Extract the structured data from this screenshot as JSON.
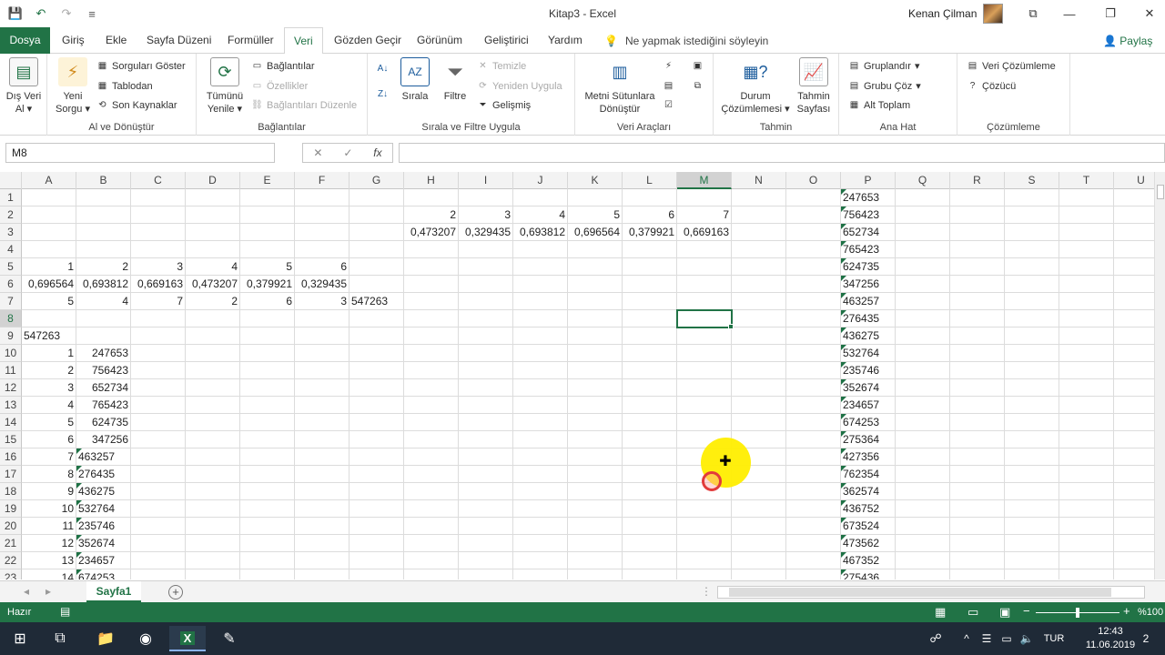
{
  "window": {
    "title": "Kitap3  -  Excel",
    "user": "Kenan Çilman"
  },
  "tabs": {
    "dosya": "Dosya",
    "giris": "Giriş",
    "ekle": "Ekle",
    "sayfa_duzeni": "Sayfa Düzeni",
    "formuller": "Formüller",
    "veri": "Veri",
    "gozden_gecir": "Gözden Geçir",
    "gorunum": "Görünüm",
    "gelistirici": "Geliştirici",
    "yardim": "Yardım",
    "tell_me": "Ne yapmak istediğini söyleyin",
    "share": "Paylaş"
  },
  "ribbon": {
    "dis_veri": [
      "Dış Veri",
      "Al ▾"
    ],
    "yeni_sorgu": [
      "Yeni",
      "Sorgu ▾"
    ],
    "sorgulari_goster": "Sorguları Göster",
    "tablodan": "Tablodan",
    "son_kaynaklar": "Son Kaynaklar",
    "group_al": "Al ve Dönüştür",
    "tumunu_yenile": [
      "Tümünü",
      "Yenile ▾"
    ],
    "baglantilar": "Bağlantılar",
    "ozellikler": "Özellikler",
    "baglantilari_duzenle": "Bağlantıları Düzenle",
    "group_baglantilar": "Bağlantılar",
    "sirala": "Sırala",
    "filtre": "Filtre",
    "temizle": "Temizle",
    "yeniden_uygula": "Yeniden Uygula",
    "gelismis": "Gelişmiş",
    "group_sirala": "Sırala ve Filtre Uygula",
    "metni_sutunlara": [
      "Metni Sütunlara",
      "Dönüştür"
    ],
    "group_veri_araclari": "Veri Araçları",
    "durum": [
      "Durum",
      "Çözümlemesi ▾"
    ],
    "tahmin_sayfasi": [
      "Tahmin",
      "Sayfası"
    ],
    "group_tahmin": "Tahmin",
    "gruplandir": "Gruplandır",
    "grubu_coz": "Grubu Çöz",
    "alt_toplam": "Alt Toplam",
    "group_ana_hat": "Ana Hat",
    "veri_cozumleme": "Veri Çözümleme",
    "cozucu": "Çözücü",
    "group_cozumleme": "Çözümleme"
  },
  "formula_bar": {
    "name_box": "M8",
    "formula": ""
  },
  "columns": [
    "A",
    "B",
    "C",
    "D",
    "E",
    "F",
    "G",
    "H",
    "I",
    "J",
    "K",
    "L",
    "M",
    "N",
    "O",
    "P",
    "Q",
    "R",
    "S",
    "T",
    "U"
  ],
  "selected_column": "M",
  "selected_row": 8,
  "rows": [
    "1",
    "2",
    "3",
    "4",
    "5",
    "6",
    "7",
    "8",
    "9",
    "10",
    "11",
    "12",
    "13",
    "14",
    "15",
    "16",
    "17",
    "18",
    "19",
    "20",
    "21",
    "22",
    "23"
  ],
  "cells": [
    {
      "c": "H",
      "r": 2,
      "v": "2",
      "a": "r"
    },
    {
      "c": "I",
      "r": 2,
      "v": "3",
      "a": "r"
    },
    {
      "c": "J",
      "r": 2,
      "v": "4",
      "a": "r"
    },
    {
      "c": "K",
      "r": 2,
      "v": "5",
      "a": "r"
    },
    {
      "c": "L",
      "r": 2,
      "v": "6",
      "a": "r"
    },
    {
      "c": "M",
      "r": 2,
      "v": "7",
      "a": "r"
    },
    {
      "c": "H",
      "r": 3,
      "v": "0,473207",
      "a": "r"
    },
    {
      "c": "I",
      "r": 3,
      "v": "0,329435",
      "a": "r"
    },
    {
      "c": "J",
      "r": 3,
      "v": "0,693812",
      "a": "r"
    },
    {
      "c": "K",
      "r": 3,
      "v": "0,696564",
      "a": "r"
    },
    {
      "c": "L",
      "r": 3,
      "v": "0,379921",
      "a": "r"
    },
    {
      "c": "M",
      "r": 3,
      "v": "0,669163",
      "a": "r"
    },
    {
      "c": "A",
      "r": 5,
      "v": "1",
      "a": "r"
    },
    {
      "c": "B",
      "r": 5,
      "v": "2",
      "a": "r"
    },
    {
      "c": "C",
      "r": 5,
      "v": "3",
      "a": "r"
    },
    {
      "c": "D",
      "r": 5,
      "v": "4",
      "a": "r"
    },
    {
      "c": "E",
      "r": 5,
      "v": "5",
      "a": "r"
    },
    {
      "c": "F",
      "r": 5,
      "v": "6",
      "a": "r"
    },
    {
      "c": "A",
      "r": 6,
      "v": "0,696564",
      "a": "r"
    },
    {
      "c": "B",
      "r": 6,
      "v": "0,693812",
      "a": "r"
    },
    {
      "c": "C",
      "r": 6,
      "v": "0,669163",
      "a": "r"
    },
    {
      "c": "D",
      "r": 6,
      "v": "0,473207",
      "a": "r"
    },
    {
      "c": "E",
      "r": 6,
      "v": "0,379921",
      "a": "r"
    },
    {
      "c": "F",
      "r": 6,
      "v": "0,329435",
      "a": "r"
    },
    {
      "c": "A",
      "r": 7,
      "v": "5",
      "a": "r"
    },
    {
      "c": "B",
      "r": 7,
      "v": "4",
      "a": "r"
    },
    {
      "c": "C",
      "r": 7,
      "v": "7",
      "a": "r"
    },
    {
      "c": "D",
      "r": 7,
      "v": "2",
      "a": "r"
    },
    {
      "c": "E",
      "r": 7,
      "v": "6",
      "a": "r"
    },
    {
      "c": "F",
      "r": 7,
      "v": "3",
      "a": "r"
    },
    {
      "c": "G",
      "r": 7,
      "v": "547263",
      "a": "l"
    },
    {
      "c": "A",
      "r": 9,
      "v": "547263",
      "a": "l"
    },
    {
      "c": "A",
      "r": 10,
      "v": "1",
      "a": "r"
    },
    {
      "c": "B",
      "r": 10,
      "v": "247653",
      "a": "r"
    },
    {
      "c": "A",
      "r": 11,
      "v": "2",
      "a": "r"
    },
    {
      "c": "B",
      "r": 11,
      "v": "756423",
      "a": "r"
    },
    {
      "c": "A",
      "r": 12,
      "v": "3",
      "a": "r"
    },
    {
      "c": "B",
      "r": 12,
      "v": "652734",
      "a": "r"
    },
    {
      "c": "A",
      "r": 13,
      "v": "4",
      "a": "r"
    },
    {
      "c": "B",
      "r": 13,
      "v": "765423",
      "a": "r"
    },
    {
      "c": "A",
      "r": 14,
      "v": "5",
      "a": "r"
    },
    {
      "c": "B",
      "r": 14,
      "v": "624735",
      "a": "r"
    },
    {
      "c": "A",
      "r": 15,
      "v": "6",
      "a": "r"
    },
    {
      "c": "B",
      "r": 15,
      "v": "347256",
      "a": "r"
    },
    {
      "c": "A",
      "r": 16,
      "v": "7",
      "a": "r"
    },
    {
      "c": "B",
      "r": 16,
      "v": "463257",
      "a": "l",
      "t": 1
    },
    {
      "c": "A",
      "r": 17,
      "v": "8",
      "a": "r"
    },
    {
      "c": "B",
      "r": 17,
      "v": "276435",
      "a": "l",
      "t": 1
    },
    {
      "c": "A",
      "r": 18,
      "v": "9",
      "a": "r"
    },
    {
      "c": "B",
      "r": 18,
      "v": "436275",
      "a": "l",
      "t": 1
    },
    {
      "c": "A",
      "r": 19,
      "v": "10",
      "a": "r"
    },
    {
      "c": "B",
      "r": 19,
      "v": "532764",
      "a": "l",
      "t": 1
    },
    {
      "c": "A",
      "r": 20,
      "v": "11",
      "a": "r"
    },
    {
      "c": "B",
      "r": 20,
      "v": "235746",
      "a": "l",
      "t": 1
    },
    {
      "c": "A",
      "r": 21,
      "v": "12",
      "a": "r"
    },
    {
      "c": "B",
      "r": 21,
      "v": "352674",
      "a": "l",
      "t": 1
    },
    {
      "c": "A",
      "r": 22,
      "v": "13",
      "a": "r"
    },
    {
      "c": "B",
      "r": 22,
      "v": "234657",
      "a": "l",
      "t": 1
    },
    {
      "c": "A",
      "r": 23,
      "v": "14",
      "a": "r"
    },
    {
      "c": "B",
      "r": 23,
      "v": "674253",
      "a": "l",
      "t": 1
    },
    {
      "c": "P",
      "r": 1,
      "v": "247653",
      "a": "l",
      "t": 1
    },
    {
      "c": "P",
      "r": 2,
      "v": "756423",
      "a": "l",
      "t": 1
    },
    {
      "c": "P",
      "r": 3,
      "v": "652734",
      "a": "l",
      "t": 1
    },
    {
      "c": "P",
      "r": 4,
      "v": "765423",
      "a": "l",
      "t": 1
    },
    {
      "c": "P",
      "r": 5,
      "v": "624735",
      "a": "l",
      "t": 1
    },
    {
      "c": "P",
      "r": 6,
      "v": "347256",
      "a": "l",
      "t": 1
    },
    {
      "c": "P",
      "r": 7,
      "v": "463257",
      "a": "l",
      "t": 1
    },
    {
      "c": "P",
      "r": 8,
      "v": "276435",
      "a": "l",
      "t": 1
    },
    {
      "c": "P",
      "r": 9,
      "v": "436275",
      "a": "l",
      "t": 1
    },
    {
      "c": "P",
      "r": 10,
      "v": "532764",
      "a": "l",
      "t": 1
    },
    {
      "c": "P",
      "r": 11,
      "v": "235746",
      "a": "l",
      "t": 1
    },
    {
      "c": "P",
      "r": 12,
      "v": "352674",
      "a": "l",
      "t": 1
    },
    {
      "c": "P",
      "r": 13,
      "v": "234657",
      "a": "l",
      "t": 1
    },
    {
      "c": "P",
      "r": 14,
      "v": "674253",
      "a": "l",
      "t": 1
    },
    {
      "c": "P",
      "r": 15,
      "v": "275364",
      "a": "l",
      "t": 1
    },
    {
      "c": "P",
      "r": 16,
      "v": "427356",
      "a": "l",
      "t": 1
    },
    {
      "c": "P",
      "r": 17,
      "v": "762354",
      "a": "l",
      "t": 1
    },
    {
      "c": "P",
      "r": 18,
      "v": "362574",
      "a": "l",
      "t": 1
    },
    {
      "c": "P",
      "r": 19,
      "v": "436752",
      "a": "l",
      "t": 1
    },
    {
      "c": "P",
      "r": 20,
      "v": "673524",
      "a": "l",
      "t": 1
    },
    {
      "c": "P",
      "r": 21,
      "v": "473562",
      "a": "l",
      "t": 1
    },
    {
      "c": "P",
      "r": 22,
      "v": "467352",
      "a": "l",
      "t": 1
    },
    {
      "c": "P",
      "r": 23,
      "v": "275436",
      "a": "l",
      "t": 1
    }
  ],
  "sheet": {
    "tab": "Sayfa1"
  },
  "status": {
    "ready": "Hazır",
    "zoom": "%100"
  },
  "taskbar": {
    "lang": "TUR",
    "time": "12:43",
    "date": "11.06.2019",
    "notifications": "2"
  },
  "colors": {
    "excel_green": "#217346",
    "selection": "#217346"
  }
}
